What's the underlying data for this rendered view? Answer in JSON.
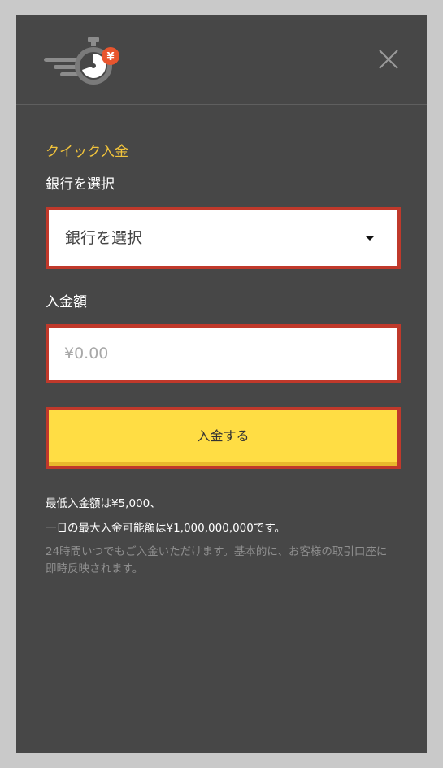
{
  "colors": {
    "backdrop": "#c9c9c9",
    "modal_bg": "#474747",
    "accent_yellow": "#f2c43c",
    "button_yellow": "#ffdd44",
    "highlight_border": "#c0392b",
    "badge_orange": "#e8552e"
  },
  "header": {
    "logo_icon": "stopwatch-yen-icon",
    "logo_badge": "¥",
    "close_icon": "close-icon"
  },
  "form": {
    "title": "クイック入金",
    "bank_label": "銀行を選択",
    "bank_select_value": "銀行を選択",
    "amount_label": "入金額",
    "amount_placeholder": "¥0.00",
    "submit_label": "入金する"
  },
  "info": {
    "min_deposit": "最低入金額は¥5,000、",
    "max_deposit": "一日の最大入金可能額は¥1,000,000,000です。",
    "note": "24時間いつでもご入金いただけます。基本的に、お客様の取引口座に即時反映されます。"
  }
}
